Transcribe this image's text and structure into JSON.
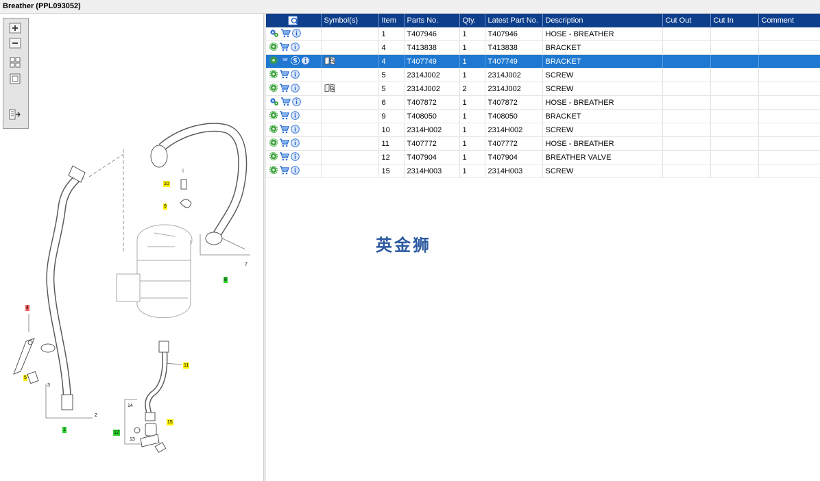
{
  "window": {
    "title": "Breather (PPL093052)"
  },
  "toolbox": {
    "buttons": [
      {
        "name": "zoom-in-button",
        "icon": "zoom-in-icon"
      },
      {
        "name": "zoom-out-button",
        "icon": "zoom-out-icon"
      },
      {
        "name": "fit-all-button",
        "icon": "fit-all-icon"
      },
      {
        "name": "actual-size-button",
        "icon": "actual-size-icon"
      },
      {
        "name": "export-list-button",
        "icon": "export-list-icon"
      }
    ]
  },
  "diagram": {
    "callouts": [
      {
        "text": "10",
        "style": "yellow"
      },
      {
        "text": "9",
        "style": "yellow"
      },
      {
        "text": "7",
        "style": "plain"
      },
      {
        "text": "8",
        "style": "green"
      },
      {
        "text": "4",
        "style": "red"
      },
      {
        "text": "5",
        "style": "yellow"
      },
      {
        "text": "3",
        "style": "plain"
      },
      {
        "text": "2",
        "style": "plain"
      },
      {
        "text": "1",
        "style": "green"
      },
      {
        "text": "11",
        "style": "yellow"
      },
      {
        "text": "14",
        "style": "plain"
      },
      {
        "text": "15",
        "style": "yellow"
      },
      {
        "text": "12",
        "style": "green"
      },
      {
        "text": "13",
        "style": "plain"
      }
    ]
  },
  "grid": {
    "columns": [
      "",
      "Symbol(s)",
      "Item",
      "Parts No.",
      "Qty.",
      "Latest Part No.",
      "Description",
      "Cut Out",
      "Cut In",
      "Comment"
    ],
    "rows": [
      {
        "item": "1",
        "part": "T407946",
        "qty": "1",
        "latest": "T407946",
        "desc": "HOSE - BREATHER",
        "icons": [
          "gears-icon",
          "cart-icon",
          "info-icon"
        ],
        "symbol": "",
        "selected": false
      },
      {
        "item": "4",
        "part": "T413838",
        "qty": "1",
        "latest": "T413838",
        "desc": "BRACKET",
        "icons": [
          "gear-icon",
          "cart-icon",
          "info-icon"
        ],
        "symbol": "",
        "selected": false
      },
      {
        "item": "4",
        "part": "T407749",
        "qty": "1",
        "latest": "T407749",
        "desc": "BRACKET",
        "icons": [
          "gear-icon",
          "cart-icon",
          "s-badge-icon",
          "info-icon"
        ],
        "symbol": "book-icon",
        "selected": true
      },
      {
        "item": "5",
        "part": "2314J002",
        "qty": "1",
        "latest": "2314J002",
        "desc": "SCREW",
        "icons": [
          "gear-icon",
          "cart-icon",
          "info-icon"
        ],
        "symbol": "",
        "selected": false
      },
      {
        "item": "5",
        "part": "2314J002",
        "qty": "2",
        "latest": "2314J002",
        "desc": "SCREW",
        "icons": [
          "gear-icon",
          "cart-icon",
          "info-icon"
        ],
        "symbol": "book-icon",
        "selected": false
      },
      {
        "item": "6",
        "part": "T407872",
        "qty": "1",
        "latest": "T407872",
        "desc": "HOSE - BREATHER",
        "icons": [
          "gears-icon",
          "cart-icon",
          "info-icon"
        ],
        "symbol": "",
        "selected": false
      },
      {
        "item": "9",
        "part": "T408050",
        "qty": "1",
        "latest": "T408050",
        "desc": "BRACKET",
        "icons": [
          "gear-icon",
          "cart-icon",
          "info-icon"
        ],
        "symbol": "",
        "selected": false
      },
      {
        "item": "10",
        "part": "2314H002",
        "qty": "1",
        "latest": "2314H002",
        "desc": "SCREW",
        "icons": [
          "gear-icon",
          "cart-icon",
          "info-icon"
        ],
        "symbol": "",
        "selected": false
      },
      {
        "item": "11",
        "part": "T407772",
        "qty": "1",
        "latest": "T407772",
        "desc": "HOSE - BREATHER",
        "icons": [
          "gear-icon",
          "cart-icon",
          "info-icon"
        ],
        "symbol": "",
        "selected": false
      },
      {
        "item": "12",
        "part": "T407904",
        "qty": "1",
        "latest": "T407904",
        "desc": "BREATHER VALVE",
        "icons": [
          "gear-icon",
          "cart-icon",
          "info-icon"
        ],
        "symbol": "",
        "selected": false
      },
      {
        "item": "15",
        "part": "2314H003",
        "qty": "1",
        "latest": "2314H003",
        "desc": "SCREW",
        "icons": [
          "gear-icon",
          "cart-icon",
          "info-icon"
        ],
        "symbol": "",
        "selected": false
      }
    ]
  },
  "watermark": {
    "text": "英金狮"
  },
  "colors": {
    "header_bg": "#0e3f8c",
    "selection_bg": "#1f78d1",
    "callout_yellow": "#fff200",
    "callout_green": "#2fd12f",
    "callout_red": "#f06060"
  }
}
